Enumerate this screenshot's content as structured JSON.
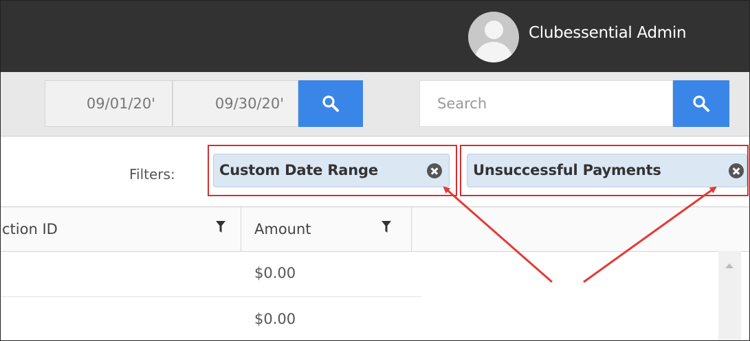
{
  "header": {
    "user_name": "Clubessential Admin",
    "avatar_icon": "user-avatar-icon"
  },
  "toolbar": {
    "start_date": "09/01/20'",
    "end_date": "09/30/20'",
    "search_placeholder": "Search",
    "search_icon": "search-icon",
    "accent_color": "#3a86e8"
  },
  "filters": {
    "label": "Filters:",
    "chips": [
      {
        "label": "Custom Date Range"
      },
      {
        "label": "Unsuccessful Payments"
      }
    ]
  },
  "table": {
    "columns": [
      {
        "label": "ction ID"
      },
      {
        "label": "Amount"
      }
    ],
    "rows": [
      {
        "amount": "$0.00"
      },
      {
        "amount": "$0.00"
      }
    ]
  },
  "annotation_color": "#d32f2f"
}
